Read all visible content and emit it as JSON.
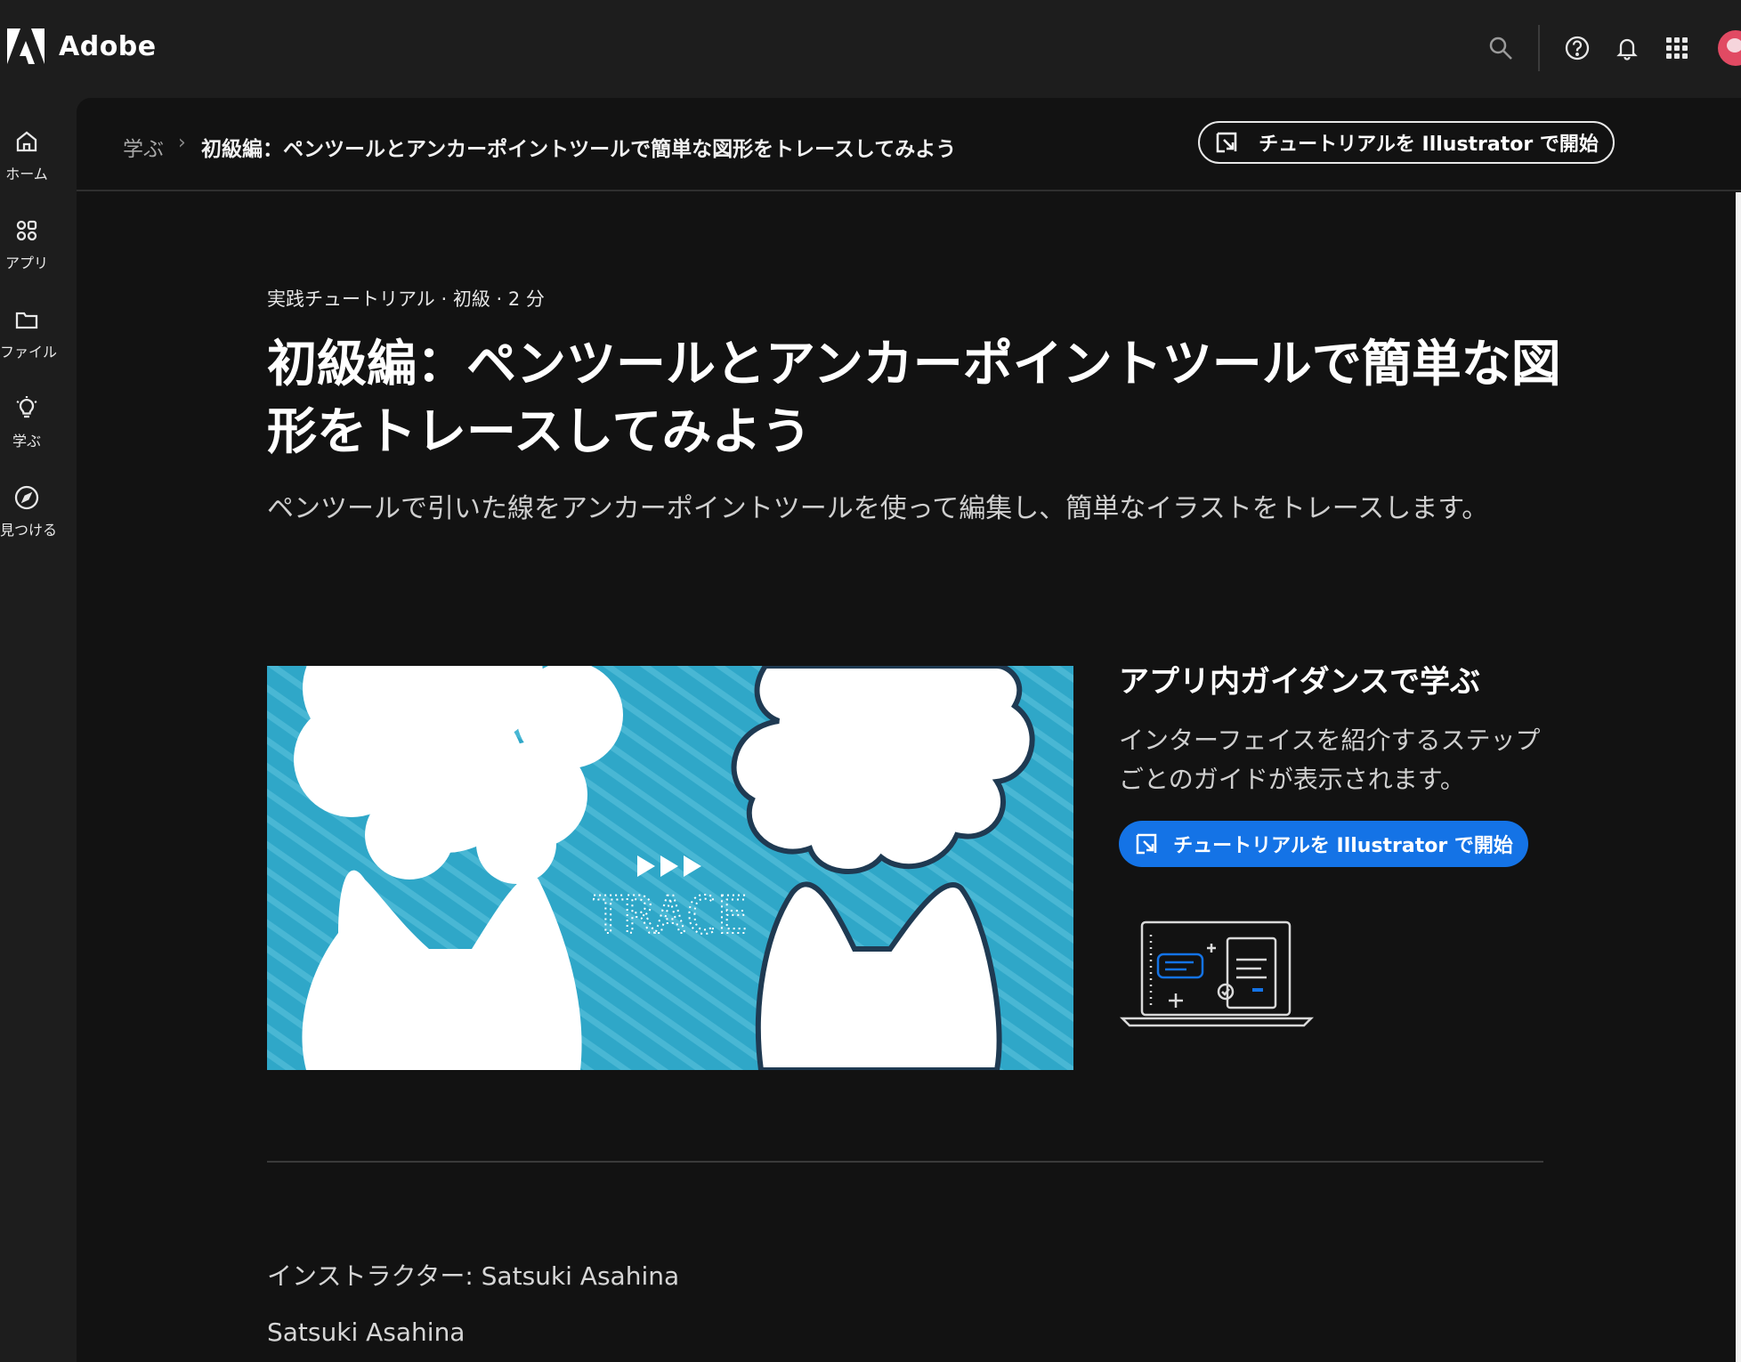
{
  "app": {
    "brand": "Adobe"
  },
  "topbar": {
    "icons": [
      "search-icon",
      "help-icon",
      "bell-icon",
      "app-grid-icon",
      "avatar"
    ]
  },
  "rail": {
    "items": [
      {
        "label": "ホーム",
        "icon": "home-icon"
      },
      {
        "label": "アプリ",
        "icon": "apps-icon"
      },
      {
        "label": "ファイル",
        "icon": "folder-icon"
      },
      {
        "label": "学ぶ",
        "icon": "lightbulb-icon"
      },
      {
        "label": "見つける",
        "icon": "compass-icon"
      }
    ]
  },
  "breadcrumb": {
    "root": "学ぶ",
    "separator": "›",
    "current": "初級編：ペンツールとアンカーポイントツールで簡単な図形をトレースしてみよう"
  },
  "header_button": {
    "label": "チュートリアルを Illustrator で開始"
  },
  "article": {
    "meta": "実践チュートリアル · 初級 · 2 分",
    "title": "初級編：ペンツールとアンカーポイントツールで簡単な図形をトレースしてみよう",
    "description": "ペンツールで引いた線をアンカーポイントツールを使って編集し、簡単なイラストをトレースします。",
    "hero_text": "TRACE",
    "instructor": "インストラクター: Satsuki Asahina",
    "author": "Satsuki Asahina"
  },
  "guidance": {
    "title": "アプリ内ガイダンスで学ぶ",
    "body": "インターフェイスを紹介するステップごとのガイドが表示されます。",
    "button_label": "チュートリアルを Illustrator で開始"
  },
  "colors": {
    "background": "#1d1d1d",
    "panel": "#121212",
    "accent_blue": "#1473e6",
    "hero_blue": "#2fa7c8",
    "hero_outline": "#1f3a52"
  }
}
